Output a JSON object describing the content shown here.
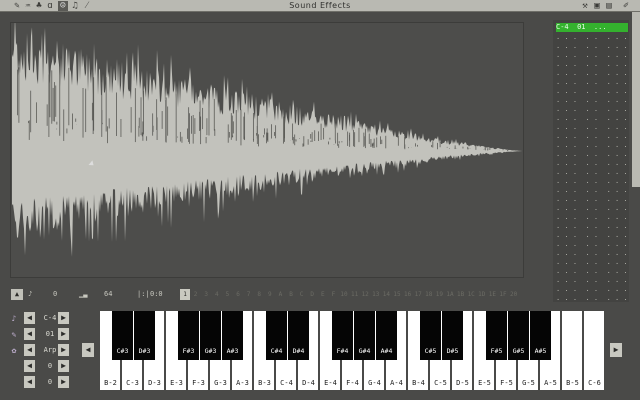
{
  "window": {
    "title": "Sound Effects"
  },
  "toolbar": {
    "left_icons": [
      "pencil-icon",
      "bucket-icon",
      "tree-icon",
      "a-icon",
      "robot-icon",
      "note-icon",
      "wand-icon"
    ],
    "right_icons": [
      "wrench-icon",
      "disk-icon",
      "page-icon",
      "pencil-right-icon"
    ]
  },
  "sound_list": {
    "selected": "C-4  01  ...",
    "rows": [
      ". . .  . .  . . .",
      ". . .  . .  . . .",
      ". . .  . .  . . .",
      ". . .  . .  . . .",
      ". . .  . .  . . .",
      ". . .  . .  . . .",
      ". . .  . .  . . .",
      ". . .  . .  . . .",
      ". . .  . .  . . .",
      ". . .  . .  . . .",
      ". . .  . .  . . .",
      ". . .  . .  . . .",
      ". . .  . .  . . .",
      ". . .  . .  . . .",
      ". . .  . .  . . .",
      ". . .  . .  . . .",
      ". . .  . .  . . .",
      ". . .  . .  . . .",
      ". . .  . .  . . .",
      ". . .  . .  . . .",
      ". . .  . .  . . .",
      ". . .  . .  . . .",
      ". . .  . .  . . .",
      ". . .  . .  . . .",
      ". . .  . .  . . .",
      ". . .  . .  . . .",
      ". . .  . .  . . .",
      ". . .  . .  . . .",
      ". . .  . .  . . .",
      ". . .  . .  . . ."
    ]
  },
  "controls": {
    "volume": "0",
    "speed": "64",
    "loop": "0:0",
    "ticks": [
      "1",
      "2",
      "3",
      "4",
      "5",
      "6",
      "7",
      "8",
      "9",
      "A",
      "B",
      "C",
      "D",
      "E",
      "F",
      "10",
      "11",
      "12",
      "13",
      "14",
      "15",
      "16",
      "17",
      "18",
      "19",
      "1A",
      "1B",
      "1C",
      "1D",
      "1E",
      "1F",
      "20"
    ]
  },
  "settings": [
    {
      "icon": "note-setting-icon",
      "value": "C-4"
    },
    {
      "icon": "instrument-icon",
      "value": "01"
    },
    {
      "icon": "effect-icon",
      "value": "Arp"
    },
    {
      "icon": "blank-icon",
      "value": "0"
    },
    {
      "icon": "blank-icon",
      "value": "0"
    }
  ],
  "keyboard": {
    "white_keys": [
      "B-2",
      "C-3",
      "D-3",
      "E-3",
      "F-3",
      "G-3",
      "A-3",
      "B-3",
      "C-4",
      "D-4",
      "E-4",
      "F-4",
      "G-4",
      "A-4",
      "B-4",
      "C-5",
      "D-5",
      "E-5",
      "F-5",
      "G-5",
      "A-5",
      "B-5",
      "C-6"
    ],
    "black_keys": [
      "C#3",
      "D#3",
      "F#3",
      "G#3",
      "A#3",
      "C#4",
      "D#4",
      "F#4",
      "G#4",
      "A#4",
      "C#5",
      "D#5",
      "F#5",
      "G#5",
      "A#5"
    ]
  },
  "colors": {
    "accent_green": "#34b12e",
    "background": "#4a4a48",
    "waveform": "#c2c2bc"
  }
}
